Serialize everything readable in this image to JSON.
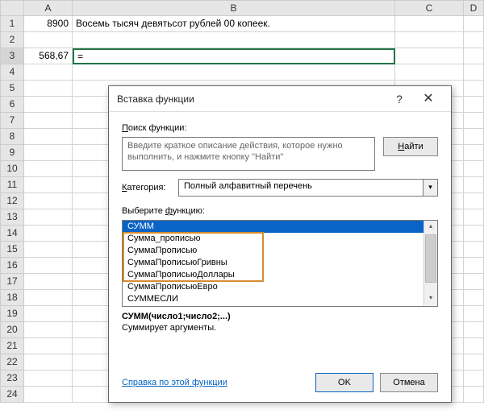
{
  "columns": [
    "A",
    "B",
    "C",
    "D"
  ],
  "rows": [
    "1",
    "2",
    "3",
    "4",
    "5",
    "6",
    "7",
    "8",
    "9",
    "10",
    "11",
    "12",
    "13",
    "14",
    "15",
    "16",
    "17",
    "18",
    "19",
    "20",
    "21",
    "22",
    "23",
    "24"
  ],
  "cells": {
    "A1": "8900",
    "B1": "Восемь тысяч девятьсот рублей  00 копеек.",
    "A3": "568,67",
    "B3": "="
  },
  "dialog": {
    "title": "Вставка функции",
    "search_label": "Поиск функции:",
    "search_placeholder": "Введите краткое описание действия, которое нужно выполнить, и нажмите кнопку \"Найти\"",
    "find_button": "Найти",
    "category_label": "Категория:",
    "category_value": "Полный алфавитный перечень",
    "select_label": "Выберите функцию:",
    "functions": [
      "СУММ",
      "Сумма_прописью",
      "СуммаПрописью",
      "СуммаПрописьюГривны",
      "СуммаПрописьюДоллары",
      "СуммаПрописьюЕвро",
      "СУММЕСЛИ"
    ],
    "selected_function": "СУММ",
    "signature": "СУММ(число1;число2;...)",
    "description": "Суммирует аргументы.",
    "help_link": "Справка по этой функции",
    "ok": "OK",
    "cancel": "Отмена"
  }
}
